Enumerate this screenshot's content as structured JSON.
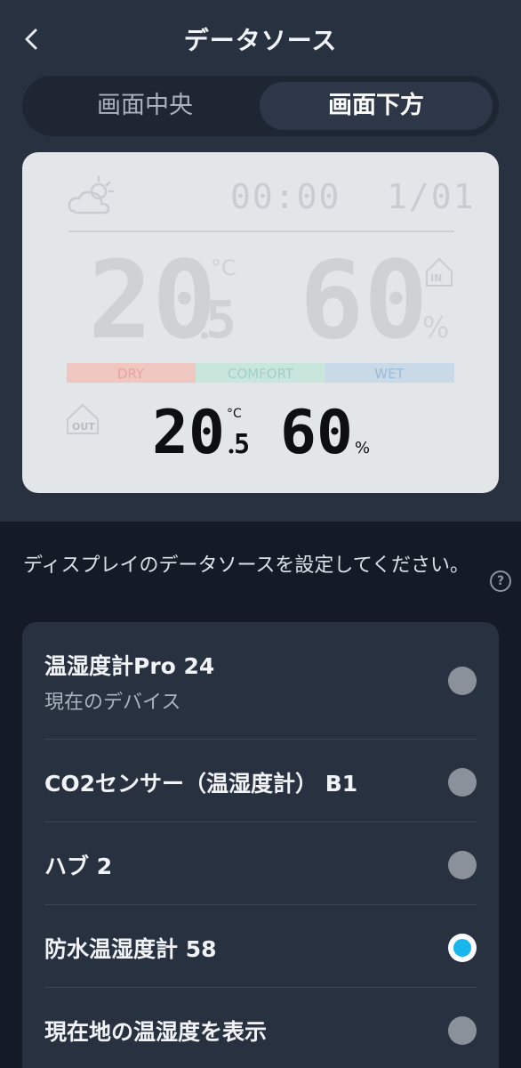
{
  "header": {
    "title": "データソース",
    "back_icon": "chevron-left-icon"
  },
  "tabs": [
    {
      "label": "画面中央",
      "selected": false
    },
    {
      "label": "画面下方",
      "selected": true
    }
  ],
  "display_preview": {
    "time": "00:00",
    "date": "1/01",
    "indoor": {
      "temp_int": "20",
      "temp_dec": "5",
      "temp_unit": "°C",
      "humidity": "60",
      "humidity_unit": "%",
      "badge": "IN"
    },
    "comfort_bar": {
      "dry": "DRY",
      "comfort": "COMFORT",
      "wet": "WET",
      "colors": {
        "dry": "#efc6c0",
        "comfort": "#c9e6dd",
        "wet": "#c9d9e8"
      }
    },
    "outdoor": {
      "temp_int": "20",
      "temp_dec": "5",
      "temp_unit": "°C",
      "humidity": "60",
      "humidity_unit": "%",
      "badge": "OUT"
    },
    "weather_icon": "partly-cloudy-icon"
  },
  "instruction": "ディスプレイのデータソースを設定してください。",
  "help_icon": "question-circle-icon",
  "sources": [
    {
      "label": "温湿度計Pro 24",
      "sub": "現在のデバイス",
      "selected": false
    },
    {
      "label": "CO2センサー（温湿度計） B1",
      "selected": false
    },
    {
      "label": "ハブ 2",
      "selected": false
    },
    {
      "label": "防水温湿度計 58",
      "selected": true
    },
    {
      "label": "現在地の温湿度を表示",
      "selected": false
    }
  ],
  "colors": {
    "accent": "#19b6ee",
    "background": "#141b26",
    "card": "#28313f"
  }
}
